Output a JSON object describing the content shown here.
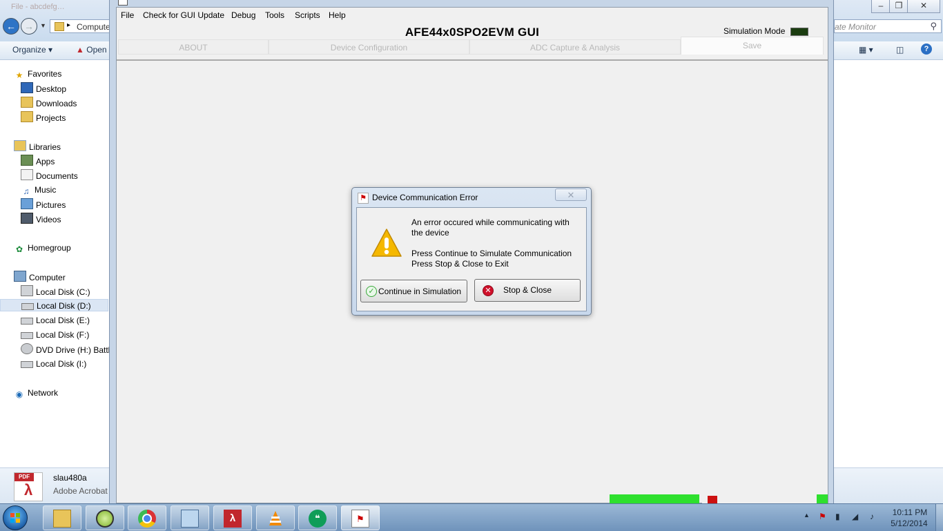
{
  "explorer": {
    "title_fragment": "File - abcdefg…",
    "address_text": "Computer",
    "search_placeholder": "Search Simulate Monitor",
    "search_visible": "ate Monitor",
    "commands": {
      "organize": "Organize",
      "open": "Open"
    },
    "nav": {
      "favorites": "Favorites",
      "desktop": "Desktop",
      "downloads": "Downloads",
      "projects": "Projects",
      "libraries": "Libraries",
      "apps": "Apps",
      "documents": "Documents",
      "music": "Music",
      "pictures": "Pictures",
      "videos": "Videos",
      "homegroup": "Homegroup",
      "computer": "Computer",
      "disk_c": "Local Disk (C:)",
      "disk_d": "Local Disk (D:)",
      "disk_e": "Local Disk (E:)",
      "disk_f": "Local Disk (F:)",
      "dvd_h": "DVD Drive (H:) Battle",
      "disk_i": "Local Disk (I:)",
      "network": "Network"
    },
    "details": {
      "file_name": "slau480a",
      "file_type": "Adobe Acrobat",
      "icon_label": "PDF"
    }
  },
  "app": {
    "window_title": "AFE44x0SPO2EVM GUI",
    "menu": [
      "File",
      "Check for GUI Update",
      "Debug",
      "Tools",
      "Scripts",
      "Help"
    ],
    "heading": "AFE44x0SPO2EVM GUI",
    "simulation_mode_label": "Simulation Mode",
    "tabs": [
      "ABOUT",
      "Device Configuration",
      "ADC Capture & Analysis",
      "Save"
    ],
    "active_tab": "Save"
  },
  "dialog": {
    "title": "Device Communication Error",
    "close_glyph": "✕",
    "message_line1": "An error occured while communicating with",
    "message_line2": "the device",
    "message_line3": "Press Continue to Simulate Communication",
    "message_line4": "Press Stop & Close to Exit",
    "continue_label": "Continue in Simulation",
    "stop_label": "Stop & Close"
  },
  "taskbar": {
    "apps": [
      "file-explorer",
      "app-green-circle",
      "chrome",
      "control-panel",
      "adobe-reader",
      "vlc",
      "hangouts",
      "afe-gui"
    ],
    "clock_time": "10:11 PM",
    "clock_date": "5/12/2014"
  },
  "colors": {
    "sim_led": "#1b3d10",
    "status_green": "#2ee02e",
    "warning_yellow": "#f5b800",
    "error_red": "#d0102a",
    "ok_green": "#3aa83a"
  }
}
